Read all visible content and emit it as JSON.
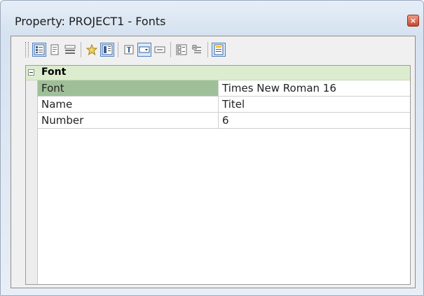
{
  "window": {
    "title": "Property: PROJECT1 - Fonts",
    "close_glyph": "×"
  },
  "toolbar": {
    "buttons": [
      {
        "icon": "categorized-view-icon",
        "active": true
      },
      {
        "icon": "property-page-icon",
        "active": false
      },
      {
        "icon": "list-view-icon",
        "active": false
      },
      {
        "icon": "favorite-star-icon",
        "active": false
      },
      {
        "icon": "grid-view-icon",
        "active": true
      },
      {
        "icon": "edit-icon",
        "active": false
      },
      {
        "icon": "dropdown-field-icon",
        "active": true
      },
      {
        "icon": "field-icon",
        "active": false
      },
      {
        "icon": "expand-all-icon",
        "active": false
      },
      {
        "icon": "collapse-all-icon",
        "active": false
      },
      {
        "icon": "description-panel-icon",
        "active": true
      }
    ]
  },
  "grid": {
    "category": {
      "label": "Font",
      "expanded": true
    },
    "rows": [
      {
        "name": "Font",
        "value": "Times New Roman 16",
        "selected": true
      },
      {
        "name": "Name",
        "value": "Titel",
        "selected": false
      },
      {
        "name": "Number",
        "value": "6",
        "selected": false
      }
    ]
  },
  "colors": {
    "category_bg": "#dcedcf",
    "selected_key_bg": "#9fbf98",
    "window_bg": "#d6e2f0",
    "active_button_border": "#4c7fbf"
  }
}
